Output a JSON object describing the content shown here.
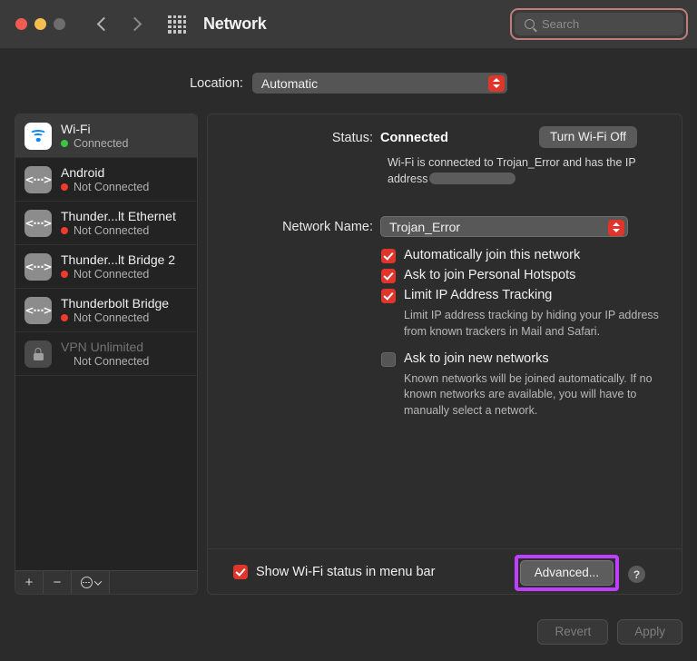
{
  "window": {
    "title": "Network",
    "traffic_lights": [
      "close-red",
      "minimize-yellow",
      "zoom-gray"
    ],
    "back_icon": "chevron-left-icon",
    "forward_icon": "chevron-right-icon",
    "grid_icon": "grid-apps-icon"
  },
  "search": {
    "placeholder": "Search",
    "value": "",
    "icon": "search-icon",
    "highlight_color": "#bd7d7a"
  },
  "location": {
    "label": "Location:",
    "value": "Automatic",
    "options": [
      "Automatic"
    ],
    "stepper_color": "#e0352b"
  },
  "sidebar": {
    "items": [
      {
        "name": "Wi-Fi",
        "status": "Connected",
        "icon": "wifi-icon",
        "dot": "green",
        "selected": true,
        "disabled": false
      },
      {
        "name": "Android",
        "status": "Not Connected",
        "icon": "ethernet-icon",
        "dot": "red",
        "selected": false,
        "disabled": false
      },
      {
        "name": "Thunder...lt Ethernet",
        "status": "Not Connected",
        "icon": "ethernet-icon",
        "dot": "red",
        "selected": false,
        "disabled": false
      },
      {
        "name": "Thunder...lt Bridge 2",
        "status": "Not Connected",
        "icon": "ethernet-icon",
        "dot": "red",
        "selected": false,
        "disabled": false
      },
      {
        "name": "Thunderbolt Bridge",
        "status": "Not Connected",
        "icon": "ethernet-icon",
        "dot": "red",
        "selected": false,
        "disabled": false
      },
      {
        "name": "VPN Unlimited",
        "status": "Not Connected",
        "icon": "lock-icon",
        "dot": "none",
        "selected": false,
        "disabled": true
      }
    ],
    "toolbar": {
      "add_label": "+",
      "remove_label": "−",
      "actions_icon": "gear-more-icon",
      "actions_chevron_icon": "chevron-down-icon"
    }
  },
  "main": {
    "status_label": "Status:",
    "status_value": "Connected",
    "turn_off_label": "Turn Wi-Fi Off",
    "description_before": "Wi-Fi is connected to Trojan_Error and has the IP address",
    "description_redacted": true,
    "network_name_label": "Network Name:",
    "network_name_value": "Trojan_Error",
    "network_name_options": [
      "Trojan_Error"
    ],
    "checkboxes": [
      {
        "label": "Automatically join this network",
        "checked": true,
        "help": ""
      },
      {
        "label": "Ask to join Personal Hotspots",
        "checked": true,
        "help": ""
      },
      {
        "label": "Limit IP Address Tracking",
        "checked": true,
        "help": "Limit IP address tracking by hiding your IP address from known trackers in Mail and Safari."
      },
      {
        "label": "Ask to join new networks",
        "checked": false,
        "help": "Known networks will be joined automatically. If no known networks are available, you will have to manually select a network."
      }
    ],
    "show_status_label": "Show Wi-Fi status in menu bar",
    "show_status_checked": true,
    "advanced_label": "Advanced...",
    "advanced_highlight_color": "#c03fff",
    "help_label": "?"
  },
  "footer": {
    "revert_label": "Revert",
    "revert_enabled": false,
    "apply_label": "Apply",
    "apply_enabled": false
  }
}
